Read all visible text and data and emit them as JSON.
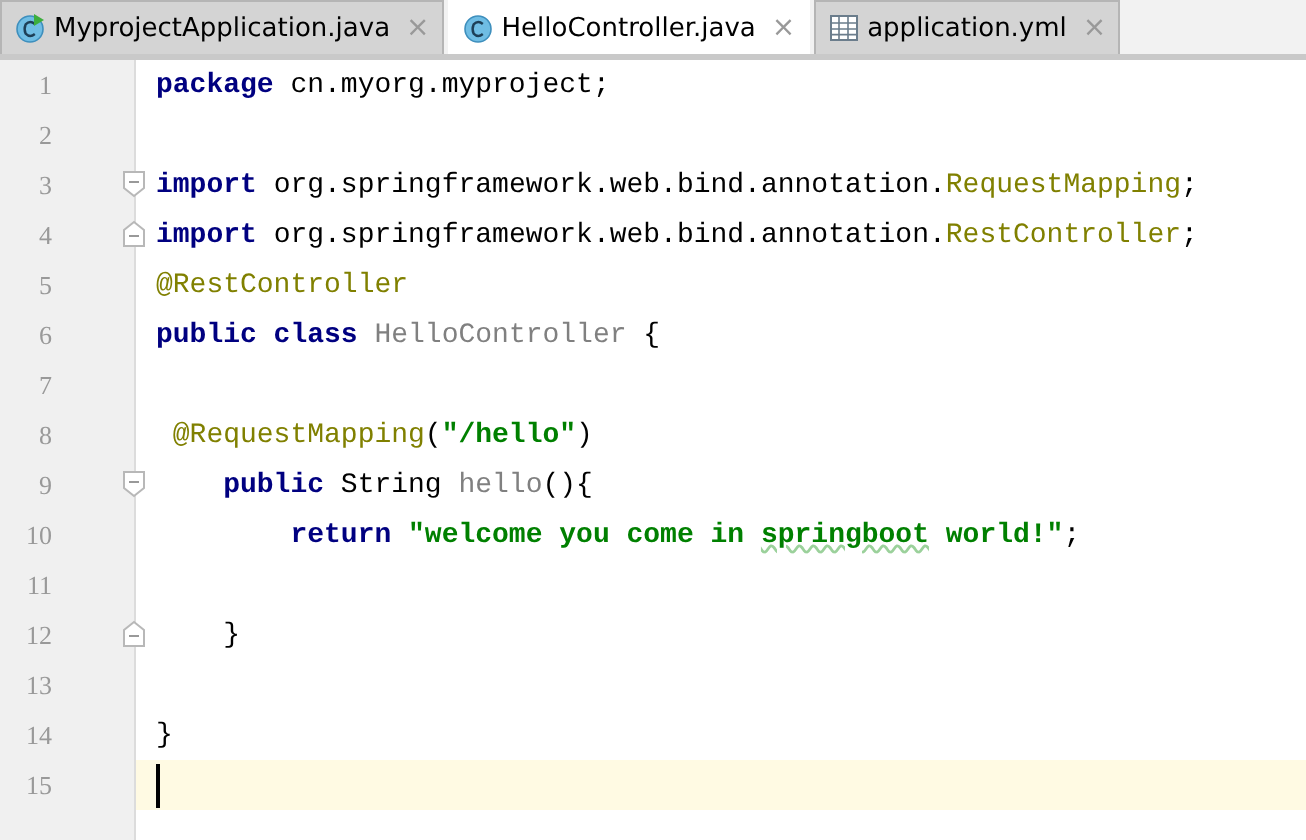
{
  "tabs": [
    {
      "label": "MyprojectApplication.java",
      "kind": "runnable-class",
      "selected": false,
      "close": "×"
    },
    {
      "label": "HelloController.java",
      "kind": "class",
      "selected": true,
      "close": "×"
    },
    {
      "label": "application.yml",
      "kind": "table",
      "selected": false,
      "close": "×"
    }
  ],
  "editor": {
    "lines": [
      {
        "number": "1",
        "tokens": [
          {
            "kind": "keyword",
            "text": "package"
          },
          {
            "kind": "plain",
            "text": " cn.myorg.myproject;"
          }
        ]
      },
      {
        "number": "2"
      },
      {
        "number": "3",
        "fold_open": true,
        "tokens": [
          {
            "kind": "keyword",
            "text": "import"
          },
          {
            "kind": "plain",
            "text": " org.springframework.web.bind.annotation."
          },
          {
            "kind": "annotation",
            "text": "RequestMapping"
          },
          {
            "kind": "plain",
            "text": ";"
          }
        ]
      },
      {
        "number": "4",
        "fold_close": true,
        "tokens": [
          {
            "kind": "keyword",
            "text": "import"
          },
          {
            "kind": "plain",
            "text": " org.springframework.web.bind.annotation."
          },
          {
            "kind": "annotation",
            "text": "RestController"
          },
          {
            "kind": "plain",
            "text": ";"
          }
        ]
      },
      {
        "number": "5",
        "tokens": [
          {
            "kind": "annotation",
            "text": "@RestController"
          }
        ]
      },
      {
        "number": "6",
        "tokens": [
          {
            "kind": "keyword",
            "text": "public class"
          },
          {
            "kind": "unused",
            "text": " HelloController"
          },
          {
            "kind": "plain",
            "text": " {"
          }
        ]
      },
      {
        "number": "7"
      },
      {
        "number": "8",
        "tokens": [
          {
            "kind": "annotation",
            "text": " @RequestMapping"
          },
          {
            "kind": "plain",
            "text": "("
          },
          {
            "kind": "string",
            "text": "\"/hello\""
          },
          {
            "kind": "plain",
            "text": ")"
          }
        ]
      },
      {
        "number": "9",
        "fold_open": true,
        "tokens": [
          {
            "kind": "keyword",
            "text": "    public"
          },
          {
            "kind": "plain",
            "text": " String"
          },
          {
            "kind": "unused",
            "text": " hello"
          },
          {
            "kind": "plain",
            "text": "(){"
          }
        ]
      },
      {
        "number": "10",
        "tokens": [
          {
            "kind": "keyword",
            "text": "        return"
          },
          {
            "kind": "string",
            "text": " \"welcome you come in "
          },
          {
            "kind": "typo",
            "text": "springboot"
          },
          {
            "kind": "string",
            "text": " world!\""
          },
          {
            "kind": "plain",
            "text": ";"
          }
        ]
      },
      {
        "number": "11"
      },
      {
        "number": "12",
        "fold_close": true,
        "tokens": [
          {
            "kind": "plain",
            "text": "    }"
          }
        ]
      },
      {
        "number": "13"
      },
      {
        "number": "14",
        "tokens": [
          {
            "kind": "plain",
            "text": "}"
          }
        ]
      },
      {
        "number": "15",
        "current": true
      }
    ]
  }
}
